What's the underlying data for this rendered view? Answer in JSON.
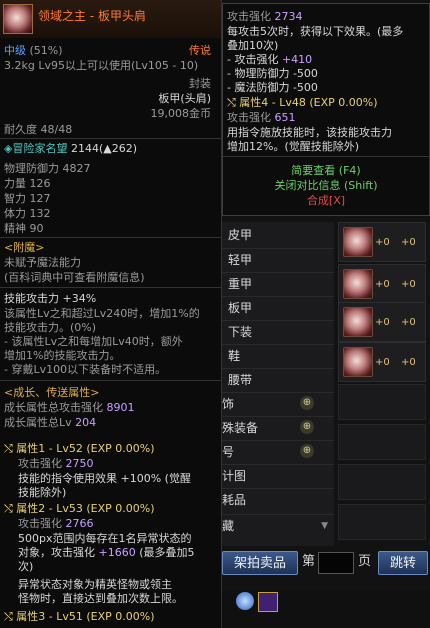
{
  "left_tooltip": {
    "item_name": "领域之主 - 板甲头肩",
    "grade": "中级",
    "grade_pct": "(51%)",
    "rarity": "传说",
    "weight": "3.2kg",
    "level_req": "Lv95以上可以使用(Lv105 - 10)",
    "sealed": "封装",
    "type": "板甲(头肩)",
    "price": "19,008金币",
    "durability": "耐久度 48/48",
    "adventurer_fame_label": "冒险家名望",
    "adventurer_fame_value": "2144(▲262)",
    "stats": [
      {
        "label": "物理防御力",
        "value": "4827"
      },
      {
        "label": "力量",
        "value": "126"
      },
      {
        "label": "智力",
        "value": "127"
      },
      {
        "label": "体力",
        "value": "132"
      },
      {
        "label": "精神",
        "value": "90"
      }
    ],
    "enchant_header": "<附魔>",
    "enchant_line1": "未赋予魔法能力",
    "enchant_line2": "(百科词典中可查看附魔信息)",
    "skill_atk": "技能攻击力 +34%",
    "skill_notes": [
      "该属性Lv之和超过Lv240时，增加1%的",
      "技能攻击力。(0%)",
      "- 该属性Lv之和每增加Lv40时，额外",
      "增加1%的技能攻击力。",
      "- 穿戴Lv100以下装备时不适用。"
    ],
    "growth_header": "<成长、传送属性>",
    "growth_total_atk_label": "成长属性总攻击强化",
    "growth_total_atk_value": "8901",
    "growth_total_lv_label": "成长属性总Lv",
    "growth_total_lv_value": "204",
    "attr1_title": "属性1 - Lv52 (EXP 0.00%)",
    "attr1_atk_label": "攻击强化",
    "attr1_atk_value": "2750",
    "attr1_desc1": "技能的指令使用效果 +100% (觉醒",
    "attr1_desc2": "技能除外)",
    "attr2_title": "属性2 - Lv53 (EXP 0.00%)",
    "attr2_atk_label": "攻击强化",
    "attr2_atk_value": "2766",
    "attr2_desc1": "500px范围内每存在1名异常状态的",
    "attr2_desc2a": "对象，攻击强化 ",
    "attr2_desc2b": "+1660",
    "attr2_desc2c": " (最多叠加5",
    "attr2_desc3": "次)",
    "attr2_desc4": "异常状态对象为精英怪物或领主",
    "attr2_desc5": "怪物时，直接达到叠加次数上限。",
    "attr3_title": "属性3 - Lv51 (EXP 0.00%)"
  },
  "right_tooltip": {
    "atk_label": "攻击强化",
    "atk_value": "2734",
    "line1": "每攻击5次时，获得以下效果。(最多",
    "line2": "叠加10次)",
    "line3a": "- 攻击强化 ",
    "line3b": "+410",
    "line4": "- 物理防御力 -500",
    "line5": "- 魔法防御力 -500",
    "attr4_title": "属性4 - Lv48 (EXP 0.00%)",
    "attr4_atk_label": "攻击强化",
    "attr4_atk_value": "651",
    "line6": "用指令施放技能时，该技能攻击力",
    "line7": "增加12%。(觉醒技能除外)",
    "brief_view": "简要查看 (F4)",
    "close_compare": "关闭对比信息 (Shift)",
    "synthesis": "合成[X]"
  },
  "categories": [
    {
      "label": "皮甲",
      "has_icon": false
    },
    {
      "label": "轻甲",
      "has_icon": false
    },
    {
      "label": "重甲",
      "has_icon": false
    },
    {
      "label": "板甲",
      "has_icon": false
    },
    {
      "label": "下装",
      "has_icon": false
    },
    {
      "label": "鞋",
      "has_icon": false
    },
    {
      "label": "腰带",
      "has_icon": false
    },
    {
      "label": "饰",
      "has_icon": true
    },
    {
      "label": "殊装备",
      "has_icon": true
    },
    {
      "label": "号",
      "has_icon": true
    },
    {
      "label": "计图",
      "has_icon": false
    },
    {
      "label": "耗品",
      "has_icon": false
    },
    {
      "label": "藏",
      "has_icon": false
    }
  ],
  "slots": [
    {
      "v1": "+0",
      "v2": "+0"
    },
    {
      "v1": "+0",
      "v2": "+0"
    },
    {
      "v1": "+0",
      "v2": "+0"
    },
    {
      "v1": "+0",
      "v2": "+0"
    }
  ],
  "bottom": {
    "auction_button": "架拍卖品",
    "page_prefix": "第",
    "page_suffix": "页",
    "jump_button": "跳转"
  },
  "icons": [
    "search-icon",
    "dropdown-icon",
    "skill-icon"
  ]
}
